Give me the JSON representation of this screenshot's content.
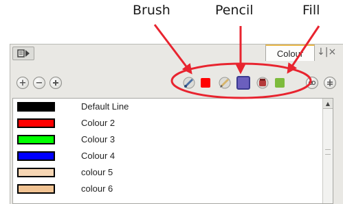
{
  "callouts": {
    "brush": "Brush",
    "pencil": "Pencil",
    "fill": "Fill"
  },
  "panel": {
    "menu_button_icon": "panel-menu-icon",
    "tab_label": "Colour",
    "tab_controls": "↓|×"
  },
  "toolbar": {
    "add_icon": "+",
    "remove_icon": "−",
    "palette_icon": "palette-icon",
    "brush_swatch_color": "#ff0000",
    "pencil_swatch_color": "#6b5fbe",
    "fill_swatch_color": "#7dbb3c",
    "link_icon": "link-icon",
    "adjust_icon": "adjust-icon"
  },
  "colours": [
    {
      "name": "Default Line",
      "color": "#000000"
    },
    {
      "name": "Colour 2",
      "color": "#ff0000"
    },
    {
      "name": "Colour 3",
      "color": "#00ff00"
    },
    {
      "name": "Colour 4",
      "color": "#0000ff"
    },
    {
      "name": "colour 5",
      "color": "#f6d6b4"
    },
    {
      "name": "colour 6",
      "color": "#f1c393"
    }
  ]
}
